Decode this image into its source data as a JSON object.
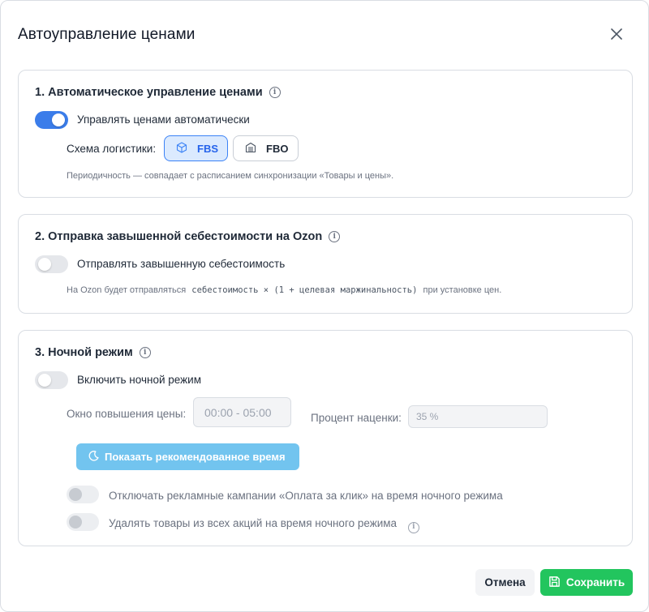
{
  "dialog": {
    "title": "Автоуправление ценами"
  },
  "section1": {
    "title": "1. Автоматическое управление ценами",
    "toggle_label": "Управлять ценами автоматически",
    "toggle_on": true,
    "logistics_label": "Схема логистики:",
    "options": [
      {
        "label": "FBS",
        "selected": true,
        "icon": "box-icon"
      },
      {
        "label": "FBO",
        "selected": false,
        "icon": "warehouse-icon"
      }
    ],
    "note": "Периодичность — совпадает с расписанием синхронизации «Товары и цены»."
  },
  "section2": {
    "title": "2. Отправка завышенной себестоимости на Ozon",
    "toggle_label": "Отправлять завышенную себестоимость",
    "toggle_on": false,
    "note_prefix": "На Ozon будет отправляться",
    "note_formula": "себестоимость × (1 + целевая маржинальность)",
    "note_suffix": "при установке цен."
  },
  "section3": {
    "title": "3. Ночной режим",
    "toggle_label": "Включить ночной режим",
    "toggle_on": false,
    "window_label": "Окно повышения цены:",
    "window_value": "00:00 - 05:00",
    "markup_label": "Процент наценки:",
    "markup_value": "35 %",
    "recommend_button": "Показать рекомендованное время",
    "ads_label": "Отключать рекламные кампании «Оплата за клик» на время ночного режима",
    "promo_label": "Удалять товары из всех акций на время ночного режима"
  },
  "footer": {
    "cancel_label": "Отмена",
    "save_label": "Сохранить"
  },
  "colors": {
    "accent": "#3b7dea",
    "save": "#22c55e",
    "recommend": "#72c4ef"
  }
}
